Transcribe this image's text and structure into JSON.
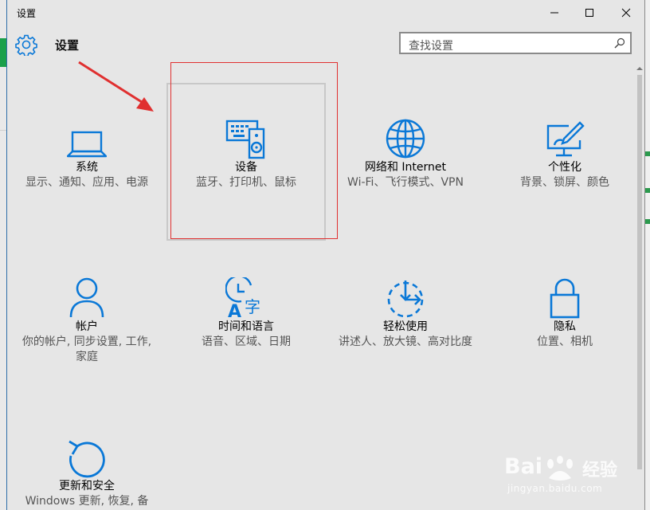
{
  "window": {
    "title": "设置",
    "controls": [
      "minimize-icon",
      "maximize-icon",
      "close-icon"
    ]
  },
  "header": {
    "title": "设置",
    "search_placeholder": "查找设置"
  },
  "tiles": [
    {
      "icon": "laptop-icon",
      "name": "系统",
      "desc": "显示、通知、应用、电源"
    },
    {
      "icon": "devices-icon",
      "name": "设备",
      "desc": "蓝牙、打印机、鼠标"
    },
    {
      "icon": "globe-icon",
      "name": "网络和 Internet",
      "desc": "Wi-Fi、飞行模式、VPN"
    },
    {
      "icon": "personalization-icon",
      "name": "个性化",
      "desc": "背景、锁屏、颜色"
    },
    {
      "icon": "person-icon",
      "name": "帐户",
      "desc": "你的帐户, 同步设置, 工作, 家庭"
    },
    {
      "icon": "time-language-icon",
      "name": "时间和语言",
      "desc": "语音、区域、日期"
    },
    {
      "icon": "ease-of-access-icon",
      "name": "轻松使用",
      "desc": "讲述人、放大镜、高对比度"
    },
    {
      "icon": "lock-icon",
      "name": "隐私",
      "desc": "位置、相机"
    },
    {
      "icon": "update-icon",
      "name": "更新和安全",
      "desc": "Windows 更新, 恢复, 备份"
    }
  ],
  "watermark": {
    "brand": "Bai",
    "brand_suffix": "经验",
    "url": "jingyan.baidu.com"
  },
  "colors": {
    "accent": "#0a78d7",
    "annotation_red": "#e03030",
    "window_bg": "#e6e6e6"
  }
}
